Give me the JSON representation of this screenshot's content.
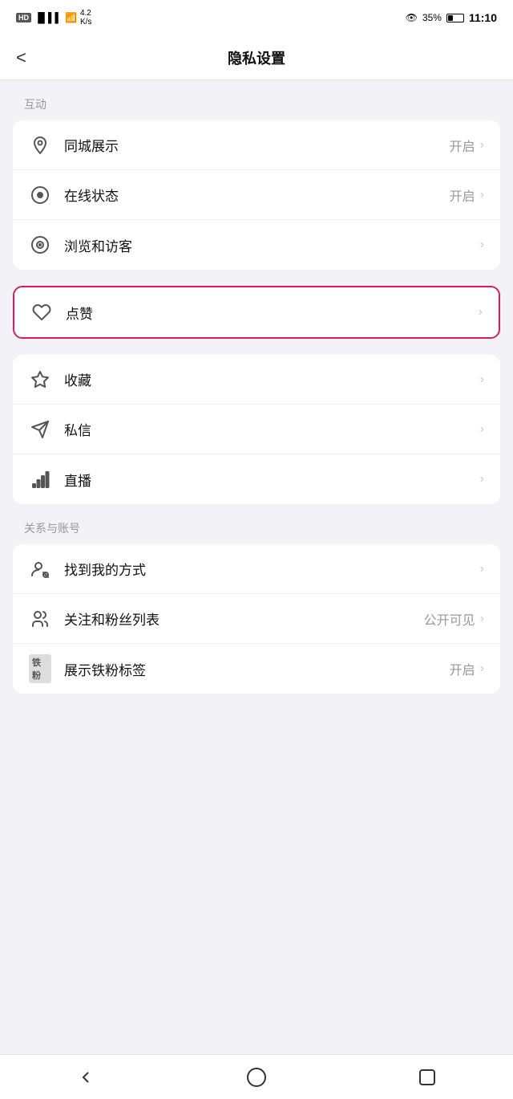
{
  "statusBar": {
    "hdLabel": "HD",
    "signal": "4G",
    "networkSpeed": "4.2\nK/s",
    "eyeIcon": "👁",
    "battery": "35%",
    "time": "11:10"
  },
  "header": {
    "title": "隐私设置",
    "backLabel": "<"
  },
  "sections": [
    {
      "label": "互动",
      "items": [
        {
          "id": "tongcheng",
          "icon": "location",
          "text": "同城展示",
          "value": "开启",
          "hasChevron": true,
          "highlighted": false
        },
        {
          "id": "zaixian",
          "icon": "online",
          "text": "在线状态",
          "value": "开启",
          "hasChevron": true,
          "highlighted": false
        },
        {
          "id": "liulan",
          "icon": "browse",
          "text": "浏览和访客",
          "value": "",
          "hasChevron": true,
          "highlighted": false
        },
        {
          "id": "dianzan",
          "icon": "heart",
          "text": "点赞",
          "value": "",
          "hasChevron": true,
          "highlighted": true
        },
        {
          "id": "shoucang",
          "icon": "star",
          "text": "收藏",
          "value": "",
          "hasChevron": true,
          "highlighted": false
        },
        {
          "id": "sixin",
          "icon": "message",
          "text": "私信",
          "value": "",
          "hasChevron": true,
          "highlighted": false
        },
        {
          "id": "zhibo",
          "icon": "live",
          "text": "直播",
          "value": "",
          "hasChevron": true,
          "highlighted": false
        }
      ]
    },
    {
      "label": "关系与账号",
      "items": [
        {
          "id": "zhaodao",
          "icon": "find",
          "text": "找到我的方式",
          "value": "",
          "hasChevron": true,
          "highlighted": false
        },
        {
          "id": "guanzhu",
          "icon": "people",
          "text": "关注和粉丝列表",
          "value": "公开可见",
          "hasChevron": true,
          "highlighted": false
        },
        {
          "id": "tiefenbiao",
          "icon": "tiepen",
          "text": "展示铁粉标签",
          "value": "开启",
          "hasChevron": true,
          "highlighted": false
        }
      ]
    }
  ],
  "bottomNav": {
    "backLabel": "◁",
    "homeLabel": "○",
    "recentLabel": "□"
  }
}
